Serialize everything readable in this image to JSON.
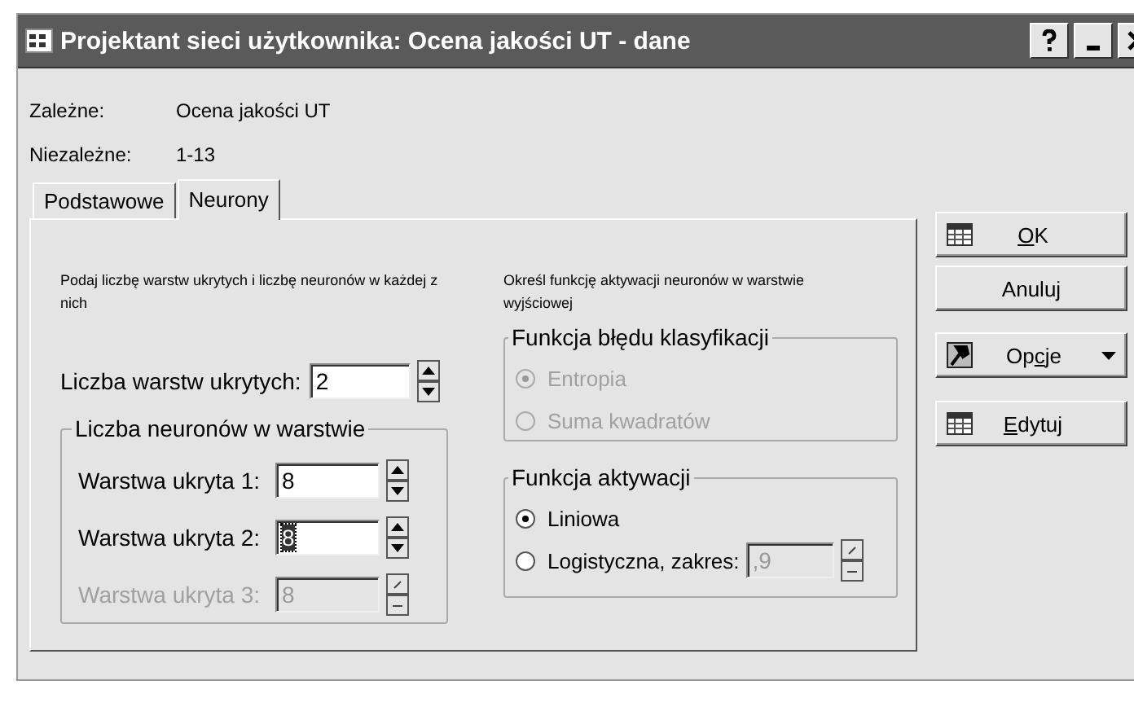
{
  "window": {
    "title": "Projektant sieci użytkownika: Ocena jakości UT - dane"
  },
  "info": [
    {
      "label": "Zależne:",
      "value": "Ocena jakości UT"
    },
    {
      "label": "Niezależne:",
      "value": "1-13"
    }
  ],
  "tabs": [
    {
      "label": "Podstawowe",
      "selected": false
    },
    {
      "label": "Neurony",
      "selected": true
    }
  ],
  "left_description": "Podaj liczbę warstw ukrytych i liczbę neuronów w każdej z nich",
  "hidden_layers": {
    "label": "Liczba warstw ukrytych:",
    "value": "2"
  },
  "neurons_group": {
    "title": "Liczba neuronów w warstwie",
    "rows": [
      {
        "label": "Warstwa ukryta 1:",
        "value": "8",
        "disabled": false,
        "focused": false
      },
      {
        "label": "Warstwa ukryta 2:",
        "value": "8",
        "disabled": false,
        "focused": true
      },
      {
        "label": "Warstwa ukryta 3:",
        "value": "8",
        "disabled": true,
        "focused": false
      }
    ]
  },
  "right_description": "Określ funkcję aktywacji neuronów w warstwie wyjściowej",
  "groups": [
    {
      "title": "Funkcja błędu klasyfikacji",
      "options": [
        {
          "label": "Entropia",
          "selected": true,
          "disabled": true
        },
        {
          "label": "Suma kwadratów",
          "selected": false,
          "disabled": true
        }
      ]
    },
    {
      "title": "Funkcja aktywacji",
      "options": [
        {
          "label": "Liniowa",
          "selected": true,
          "disabled": false
        },
        {
          "label": "Logistyczna, zakres:",
          "selected": false,
          "disabled": false,
          "field": {
            "value": ",9",
            "disabled": true
          }
        }
      ]
    }
  ],
  "buttons": [
    {
      "access_key": "O",
      "text_after": "K",
      "kind": "table"
    },
    {
      "text_before": "Anuluj",
      "kind": "plain"
    },
    {
      "text_before": "Op",
      "access_key": "c",
      "text_after": "je",
      "kind": "tool",
      "dropdown": true
    },
    {
      "access_key": "E",
      "text_after": "dytuj",
      "kind": "table"
    }
  ]
}
